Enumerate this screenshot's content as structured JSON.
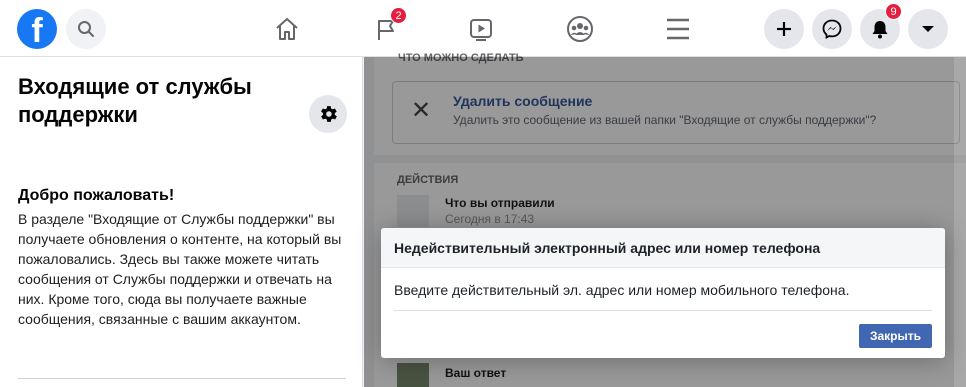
{
  "topbar": {
    "logo_letter": "f",
    "pages_badge": "2",
    "notifications_badge": "9"
  },
  "left_panel": {
    "title": "Входящие от службы поддержки",
    "welcome_title": "Добро пожаловать!",
    "welcome_text": "В разделе \"Входящие от Службы поддержки\" вы получаете обновления о контенте, на который вы пожаловались. Здесь вы также можете читать сообщения от Службы поддержки и отвечать на них. Кроме того, сюда вы получаете важные сообщения, связанные с вашим аккаунтом."
  },
  "right_panel": {
    "what_you_can_do_label": "Что можно сделать",
    "delete_title": "Удалить сообщение",
    "delete_subtitle": "Удалить это сообщение из вашей папки \"Входящие от службы поддержки\"?",
    "actions_label": "Действия",
    "sent_title": "Что вы отправили",
    "sent_time": "Сегодня в 17:43",
    "reply_title": "Ваш ответ"
  },
  "dialog": {
    "title": "Недействительный электронный адрес или номер телефона",
    "message": "Введите действительный эл. адрес или номер мобильного телефона.",
    "close_label": "Закрыть"
  },
  "colors": {
    "brand": "#1877f2",
    "badge": "#e41e3f",
    "button": "#4267b2"
  }
}
